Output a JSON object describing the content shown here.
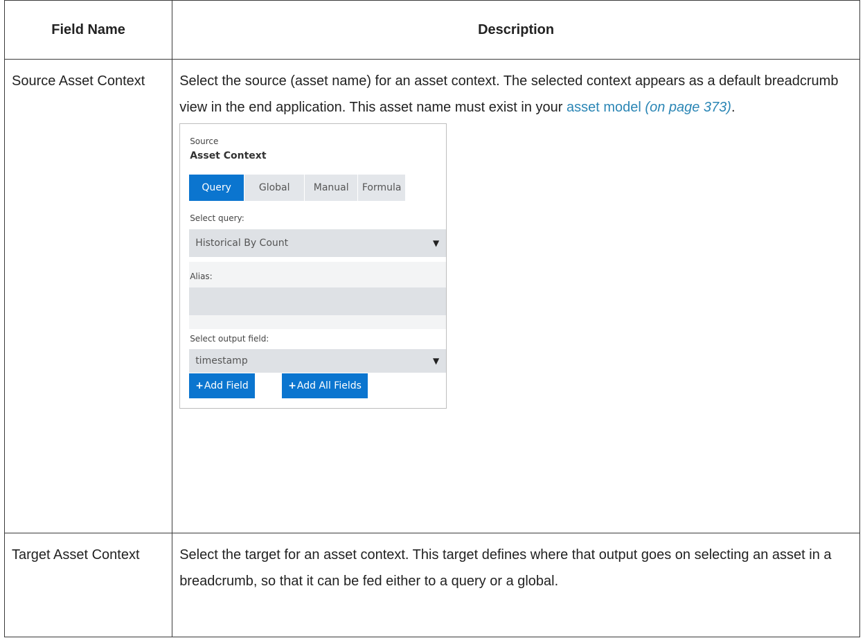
{
  "table": {
    "headers": [
      "Field Name",
      "Description"
    ],
    "rows": [
      {
        "field_name": "Source Asset Context",
        "description_text": "Select the source (asset name) for an asset context. The selected context appears as a default breadcrumb view in the end application. This asset name must exist in your ",
        "link_text": "asset model",
        "link_page": "(on page 373)",
        "trailing": "."
      },
      {
        "field_name": "Target Asset Context",
        "description_text": "Select the target for an asset context. This target defines where that output goes on selecting an asset in a breadcrumb, so that it can be fed either to a query or a global."
      }
    ]
  },
  "panel": {
    "eyebrow": "Source",
    "title": "Asset Context",
    "tabs": [
      "Query",
      "Global",
      "Manual",
      "Formula"
    ],
    "active_tab": "Query",
    "select_query_label": "Select query:",
    "select_query_value": "Historical By Count",
    "alias_label": "Alias:",
    "alias_value": "",
    "select_output_label": "Select output field:",
    "select_output_value": "timestamp",
    "add_field_label": "Add Field",
    "add_all_fields_label": "Add All Fields"
  },
  "colors": {
    "accent": "#0b75cf",
    "link": "#2b86b5"
  }
}
